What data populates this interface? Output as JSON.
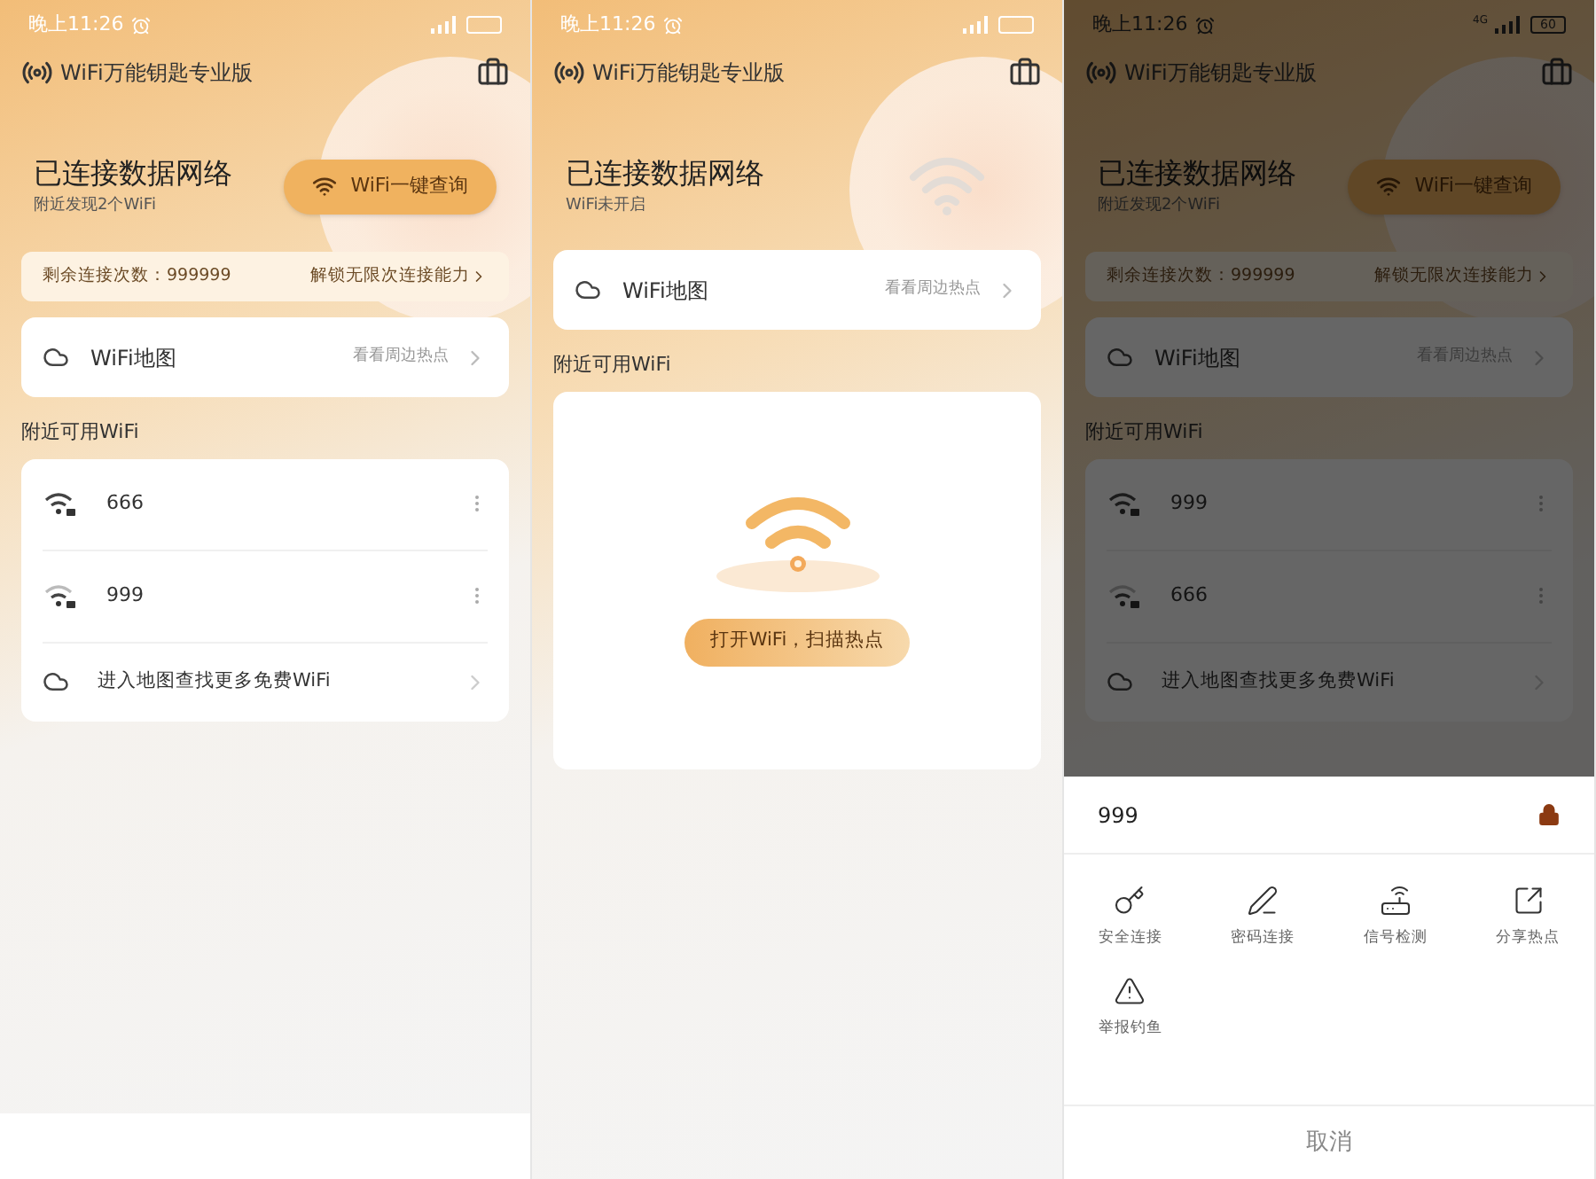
{
  "screens": [
    {
      "kind": "connected",
      "dimmed": false,
      "bottom_bar": true,
      "status_bar": {
        "time": "晚上11:26"
      },
      "app_title": "WiFi万能钥匙专业版",
      "header": {
        "title": "已连接数据网络",
        "subtitle": "附近发现2个WiFi"
      },
      "query_button": "WiFi一键查询",
      "quota": {
        "label": "剩余连接次数：999999",
        "link": "解锁无限次连接能力"
      },
      "map_card": {
        "title": "WiFi地图",
        "hint": "看看周边热点"
      },
      "section_title": "附近可用WiFi",
      "wifi_list": [
        {
          "name": "666"
        },
        {
          "name": "999"
        }
      ],
      "more_link": "进入地图查找更多免费WiFi"
    },
    {
      "kind": "wifi_off",
      "dimmed": false,
      "bottom_bar": false,
      "status_bar": {
        "time": "晚上11:26"
      },
      "app_title": "WiFi万能钥匙专业版",
      "header": {
        "title": "已连接数据网络",
        "subtitle": "WiFi未开启"
      },
      "map_card": {
        "title": "WiFi地图",
        "hint": "看看周边热点"
      },
      "section_title": "附近可用WiFi",
      "empty_state": {
        "button": "打开WiFi，扫描热点"
      }
    },
    {
      "kind": "connected",
      "dimmed": true,
      "bottom_bar": false,
      "status_bar": {
        "time": "晚上11:26",
        "network": "4G",
        "battery": "60"
      },
      "app_title": "WiFi万能钥匙专业版",
      "header": {
        "title": "已连接数据网络",
        "subtitle": "附近发现2个WiFi"
      },
      "query_button": "WiFi一键查询",
      "quota": {
        "label": "剩余连接次数：999999",
        "link": "解锁无限次连接能力"
      },
      "map_card": {
        "title": "WiFi地图",
        "hint": "看看周边热点"
      },
      "section_title": "附近可用WiFi",
      "wifi_list": [
        {
          "name": "999"
        },
        {
          "name": "666"
        }
      ],
      "more_link": "进入地图查找更多免费WiFi",
      "sheet": {
        "title": "999",
        "actions": [
          {
            "kind": "key",
            "label": "安全连接"
          },
          {
            "kind": "pen",
            "label": "密码连接"
          },
          {
            "kind": "router",
            "label": "信号检测"
          },
          {
            "kind": "share",
            "label": "分享热点"
          },
          {
            "kind": "warning",
            "label": "举报钓鱼"
          }
        ],
        "cancel": "取消"
      }
    }
  ]
}
